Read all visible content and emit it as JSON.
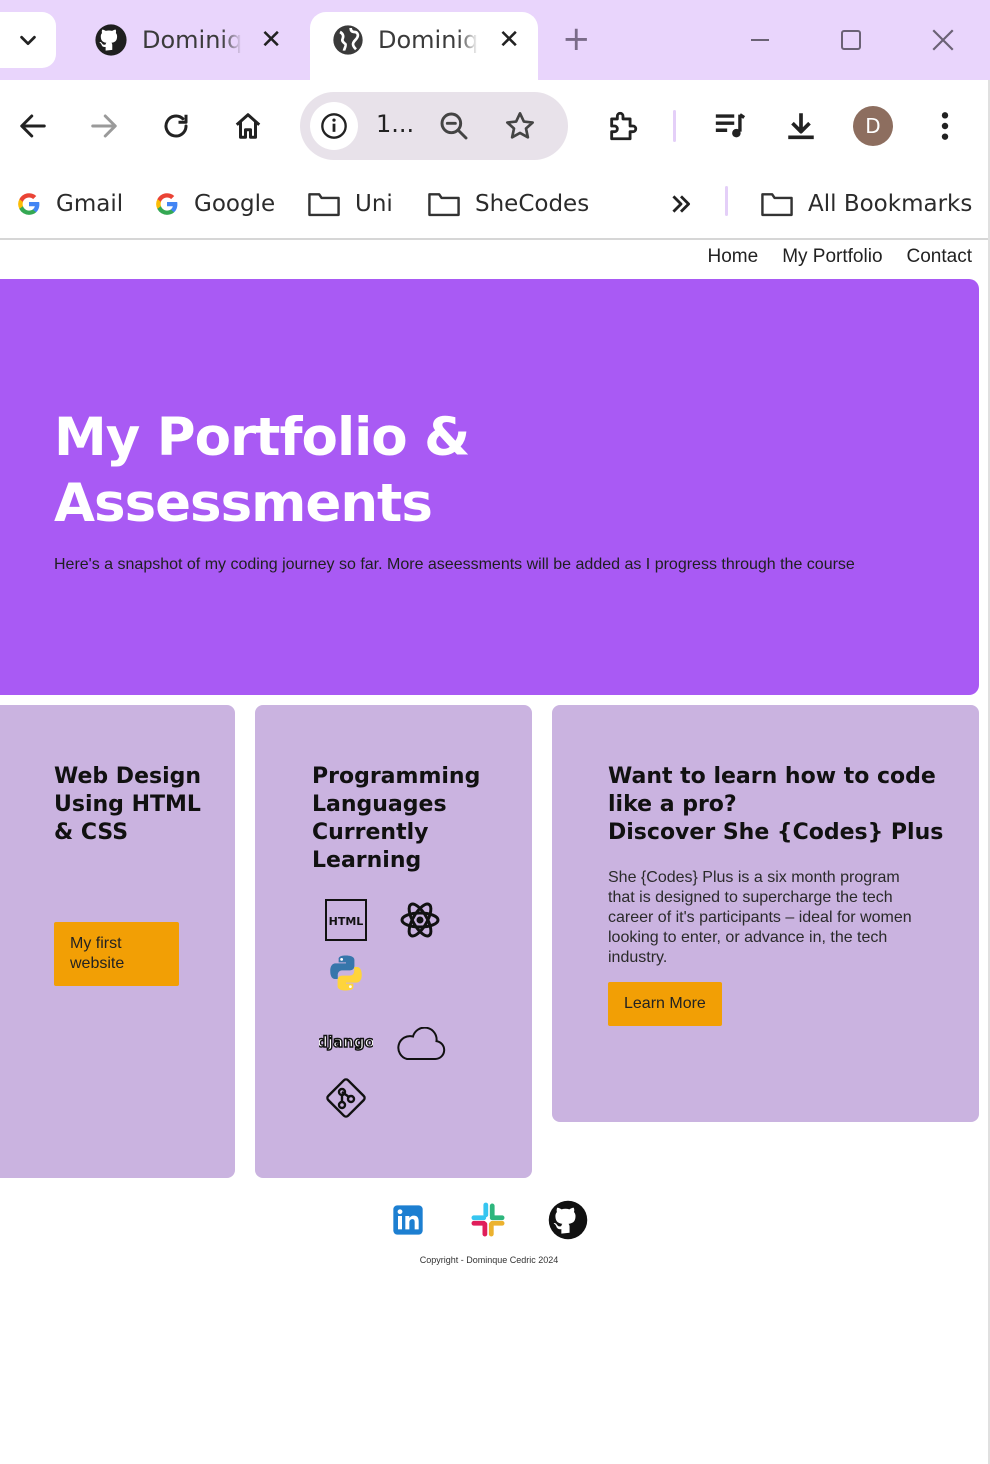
{
  "browser": {
    "tabs": [
      {
        "title": "Dominique Cedric",
        "icon": "github-icon",
        "active": false
      },
      {
        "title": "Dominique Cedric",
        "icon": "globe-icon",
        "active": true
      }
    ],
    "omnibox_text": "1...",
    "avatar_letter": "D",
    "bookmarks": [
      {
        "label": "Gmail",
        "icon": "google-icon"
      },
      {
        "label": "Google",
        "icon": "google-icon"
      },
      {
        "label": "Uni",
        "icon": "folder-icon"
      },
      {
        "label": "SheCodes",
        "icon": "folder-icon"
      }
    ],
    "all_bookmarks_label": "All Bookmarks",
    "colors": {
      "tabstrip": "#e9d5fc",
      "avatar": "#8d6e5f"
    }
  },
  "nav": {
    "home": "Home",
    "portfolio": "My Portfolio",
    "contact": "Contact"
  },
  "hero": {
    "title": "My Portfolio & Assessments",
    "subtitle": "Here's a snapshot of my coding journey so far. More aseessments will be added as I progress through the course",
    "color": "#a95af4"
  },
  "cards": {
    "web": {
      "title": "Web Design Using HTML & CSS",
      "button": "My first website"
    },
    "languages": {
      "title": "Programming Languages Currently Learning",
      "icons": [
        "html-icon",
        "react-icon",
        "python-icon",
        "django-icon",
        "cloud-icon",
        "git-icon"
      ],
      "django_label": "django",
      "html_label": "HTML"
    },
    "shecodes": {
      "title_line1": "Want to learn how to code like a pro?",
      "title_line2": "Discover She {Codes} Plus",
      "body": "She {Codes} Plus is a six month program that is designed to supercharge the tech career of it's participants – ideal for women looking to enter, or advance in, the tech industry.",
      "button": "Learn More"
    },
    "card_color": "#cab3e0",
    "button_color": "#f29f05"
  },
  "footer": {
    "social": [
      "linkedin-icon",
      "slack-icon",
      "github-icon"
    ],
    "copyright": "Copyright - Dominque Cedric 2024"
  }
}
